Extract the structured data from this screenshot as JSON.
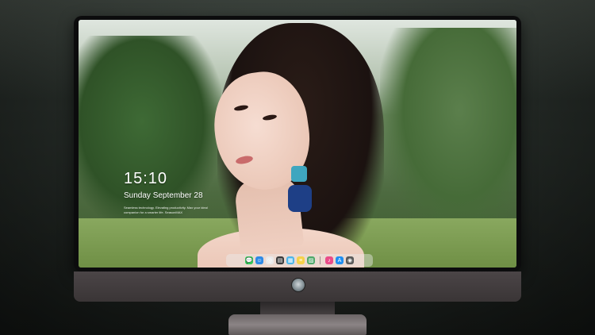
{
  "lock_screen": {
    "time": "15:10",
    "date": "Sunday September 28",
    "tagline": "Seamless technology. Elevating productivity. Max your ideal companion for a smarter life. SeasonMAX"
  },
  "dock": {
    "items": [
      {
        "name": "messages-icon",
        "color": "#33c759",
        "glyph": "💬"
      },
      {
        "name": "finder-icon",
        "color": "#2e8ae6",
        "glyph": "☺"
      },
      {
        "name": "safari-icon",
        "color": "#e9e9e9",
        "glyph": "◎"
      },
      {
        "name": "clapper-icon",
        "color": "#3a3a3a",
        "glyph": "▤"
      },
      {
        "name": "files-icon",
        "color": "#4fb6e8",
        "glyph": "▦"
      },
      {
        "name": "notes-icon",
        "color": "#f6d14a",
        "glyph": "≡"
      },
      {
        "name": "photos-icon",
        "color": "#4fa86a",
        "glyph": "▨"
      },
      {
        "name": "music-icon",
        "color": "#ea4c89",
        "glyph": "♪"
      },
      {
        "name": "appstore-icon",
        "color": "#1f8ef1",
        "glyph": "A"
      },
      {
        "name": "camera-icon",
        "color": "#5a5a5a",
        "glyph": "◉"
      }
    ]
  }
}
